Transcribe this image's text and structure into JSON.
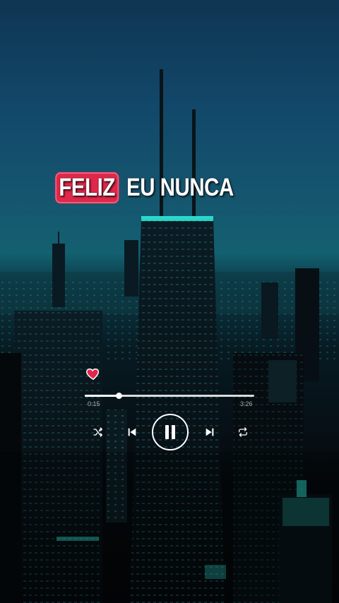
{
  "lyric": {
    "highlighted_word": "FELIZ",
    "rest": "EU NUNCA"
  },
  "player": {
    "elapsed": "0:15",
    "duration": "3:26",
    "progress_fraction": 0.2,
    "liked": true,
    "state": "playing"
  },
  "icons": {
    "heart": "heart-icon",
    "shuffle": "shuffle-icon",
    "previous": "skip-previous-icon",
    "pause": "pause-icon",
    "next": "skip-next-icon",
    "repeat": "repeat-icon"
  },
  "colors": {
    "lyric_highlight": "#e0284a",
    "heart": "#e0284a",
    "accent_light": "#2ee6d6"
  }
}
